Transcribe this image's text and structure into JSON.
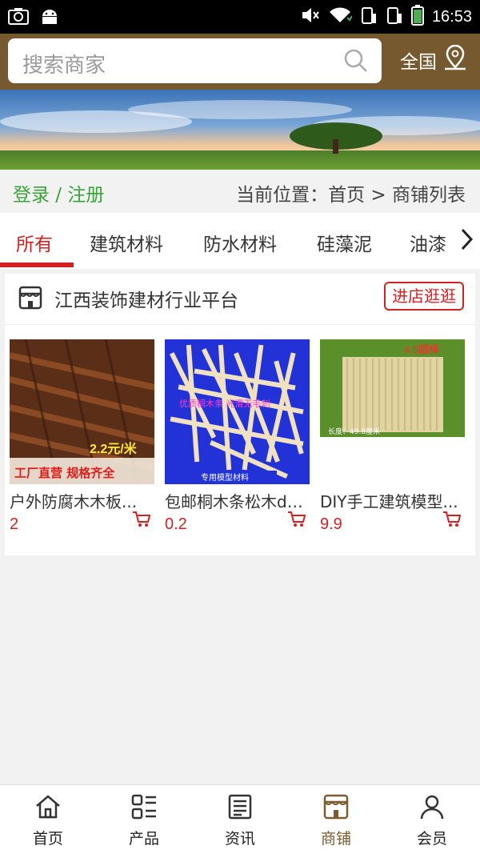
{
  "status_bar": {
    "time": "16:53"
  },
  "header": {
    "search_placeholder": "搜索商家",
    "region_label": "全国"
  },
  "breadcrumb_row": {
    "login_register": "登录 / 注册",
    "current_location": "当前位置：首页 > 商铺列表"
  },
  "tabs": [
    {
      "label": "所有",
      "active": true
    },
    {
      "label": "建筑材料",
      "active": false
    },
    {
      "label": "防水材料",
      "active": false
    },
    {
      "label": "硅藻泥",
      "active": false
    },
    {
      "label": "油漆",
      "active": false
    }
  ],
  "shop": {
    "name": "江西装饰建材行业平台",
    "enter_button": "进店逛逛",
    "products": [
      {
        "name": "户外防腐木木板...",
        "price": "2",
        "image_text": [
          "2.2元/米",
          "工厂直营 规格齐全"
        ]
      },
      {
        "name": "包邮桐木条松木di...",
        "price": "0.2",
        "image_text": [
          "优质桐木条  光滑无毛刺",
          "专用模型材料"
        ]
      },
      {
        "name": "DIY手工建筑模型...",
        "price": "9.9",
        "image_text": [
          "4.5圆棒",
          "长度：49.8厘米"
        ]
      }
    ]
  },
  "bottom_nav": [
    {
      "label": "首页",
      "icon": "home-icon",
      "active": false
    },
    {
      "label": "产品",
      "icon": "grid-list-icon",
      "active": false
    },
    {
      "label": "资讯",
      "icon": "news-icon",
      "active": false
    },
    {
      "label": "商铺",
      "icon": "shop-icon",
      "active": true
    },
    {
      "label": "会员",
      "icon": "user-icon",
      "active": false
    }
  ],
  "colors": {
    "header_brown": "#76592e",
    "accent_red": "#d6201f",
    "login_green": "#3aa33a"
  }
}
